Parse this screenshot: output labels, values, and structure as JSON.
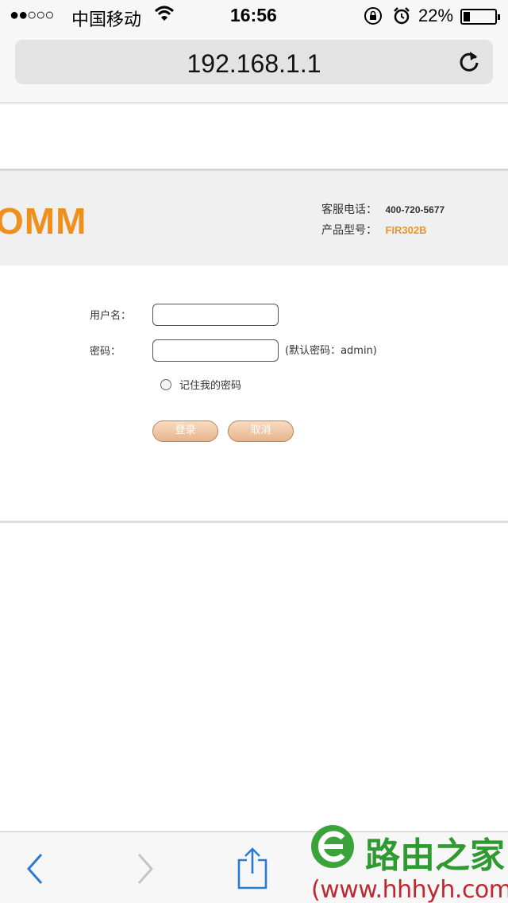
{
  "status_bar": {
    "signal": "●●○○○",
    "carrier": "中国移动",
    "time": "16:56",
    "battery_percent": "22%",
    "battery_level": 0.22
  },
  "browser": {
    "url": "192.168.1.1"
  },
  "router_header": {
    "logo_text": "OMM",
    "phone_label": "客服电话：",
    "phone_value": "400-720-5677",
    "model_label": "产品型号：",
    "model_value": "FIR302B"
  },
  "login_form": {
    "username_label": "用户名：",
    "username_value": "",
    "password_label": "密码：",
    "password_value": "",
    "password_hint": "(默认密码：admin)",
    "remember_label": "记住我的密码",
    "login_button": "登录",
    "cancel_button": "取消"
  },
  "watermark": {
    "title": "路由之家",
    "url": "(www.hhhyh.com)"
  },
  "colors": {
    "logo_orange": "#f0901c",
    "model_orange": "#e8952a",
    "button_fill": "#e6b48c",
    "ios_blue": "#2a7bd6",
    "watermark_green": "#3aa33a",
    "watermark_red": "#c0282f"
  },
  "icons": [
    "wifi-icon",
    "rotation-lock-icon",
    "alarm-icon",
    "battery-icon",
    "reload-icon",
    "back-icon",
    "forward-icon",
    "share-icon"
  ]
}
